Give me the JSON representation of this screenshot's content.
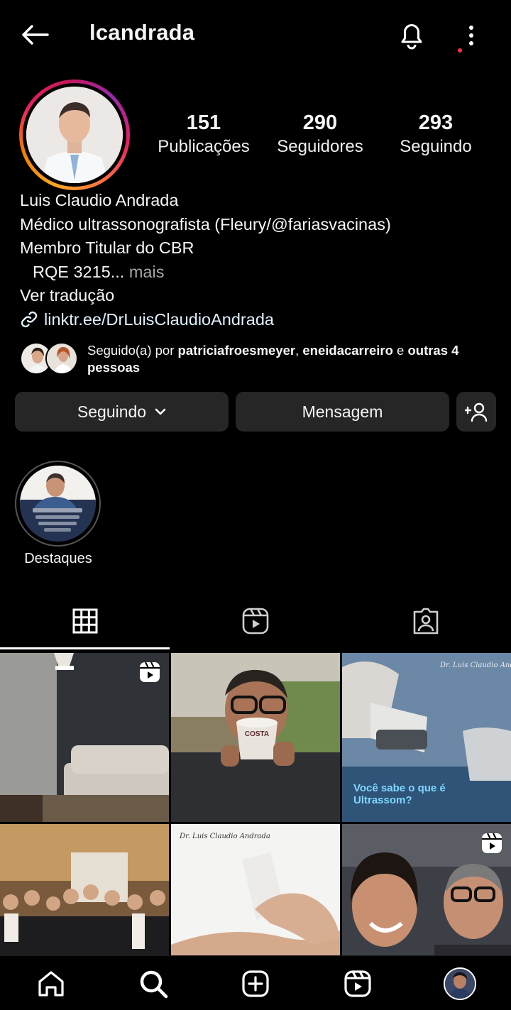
{
  "header": {
    "username": "lcandrada"
  },
  "profile": {
    "stats": [
      {
        "value": "151",
        "label": "Publicações"
      },
      {
        "value": "290",
        "label": "Seguidores"
      },
      {
        "value": "293",
        "label": "Seguindo"
      }
    ],
    "bio": {
      "name": "Luis Claudio Andrada",
      "line1": "Médico ultrassonografista (Fleury/@fariasvacinas)",
      "line2": "Membro Titular do CBR",
      "line3": "RQE 3215...",
      "more": "mais",
      "translate": "Ver tradução",
      "link": "linktr.ee/DrLuisClaudioAndrada"
    },
    "followed_by": {
      "prefix": "Seguido(a) por ",
      "user1": "patriciafroesmeyer",
      "sep": ", ",
      "user2": "eneidacarreiro",
      "mid": " e ",
      "others": "outras 4 pessoas"
    }
  },
  "actions": {
    "following_label": "Seguindo",
    "message_label": "Mensagem"
  },
  "highlights": [
    {
      "label": "Destaques"
    }
  ],
  "tabs": [
    {
      "icon": "grid-icon",
      "active": true
    },
    {
      "icon": "reels-icon",
      "active": false
    },
    {
      "icon": "tagged-icon",
      "active": false
    }
  ],
  "posts": [
    {
      "title": "",
      "overlay_text": "",
      "reel": true
    },
    {
      "title": "",
      "overlay_text": "COSTA",
      "reel": false
    },
    {
      "title": "Dr. Luis Claudio Andrada",
      "overlay_text": "Você sabe o que é Ultrassom?",
      "reel": false
    },
    {
      "title": "",
      "overlay_text": "",
      "reel": false
    },
    {
      "title": "Dr. Luis Claudio Andrada",
      "overlay_text": "",
      "reel": false
    },
    {
      "title": "",
      "overlay_text": "",
      "reel": true
    }
  ],
  "bottom_nav": [
    "home-icon",
    "search-icon",
    "create-icon",
    "reels-icon",
    "profile-avatar"
  ],
  "colors": {
    "background": "#000000",
    "button_bg": "#262626",
    "link": "#e0f1ff",
    "muted": "#a8a8a8",
    "story_ring_start": "#f9a825",
    "story_ring_end": "#c2185b",
    "notification_dot": "#ff3040"
  }
}
